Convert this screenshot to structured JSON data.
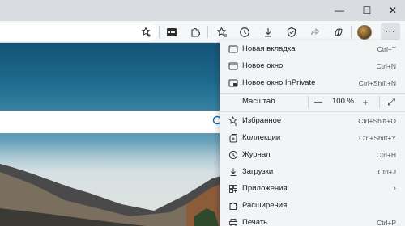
{
  "window": {
    "minimize_glyph": "—",
    "maximize_glyph": "☐",
    "close_glyph": "✕"
  },
  "toolbar": {
    "icons": [
      "favorites-add-icon",
      "extension-dark-icon",
      "extensions-icon",
      "favorites-icon",
      "history-icon",
      "downloads-icon",
      "browser-essentials-icon",
      "share-icon",
      "copilot-icon"
    ],
    "more_glyph": "⋯"
  },
  "menu": {
    "items": [
      {
        "label": "Новая вкладка",
        "shortcut": "Ctrl+T",
        "icon": "new-tab-icon"
      },
      {
        "label": "Новое окно",
        "shortcut": "Ctrl+N",
        "icon": "new-window-icon"
      },
      {
        "label": "Новое окно InPrivate",
        "shortcut": "Ctrl+Shift+N",
        "icon": "inprivate-icon"
      }
    ],
    "zoom": {
      "label": "Масштаб",
      "value": "100 %",
      "minus": "—",
      "plus": "+",
      "fullscreen": "⤢"
    },
    "items2": [
      {
        "label": "Избранное",
        "shortcut": "Ctrl+Shift+O",
        "icon": "favorites-icon"
      },
      {
        "label": "Коллекции",
        "shortcut": "Ctrl+Shift+Y",
        "icon": "collections-icon"
      },
      {
        "label": "Журнал",
        "shortcut": "Ctrl+H",
        "icon": "history-icon"
      },
      {
        "label": "Загрузки",
        "shortcut": "Ctrl+J",
        "icon": "downloads-icon"
      },
      {
        "label": "Приложения",
        "shortcut": "",
        "icon": "apps-icon",
        "submenu": "›"
      },
      {
        "label": "Расширения",
        "shortcut": "",
        "icon": "extensions-icon"
      },
      {
        "label": "Печать",
        "shortcut": "Ctrl+P",
        "icon": "print-icon"
      }
    ]
  },
  "colors": {
    "accent": "#0a6eb8",
    "menu_bg": "#f3f4f6",
    "titlebar": "#d9dde2"
  }
}
